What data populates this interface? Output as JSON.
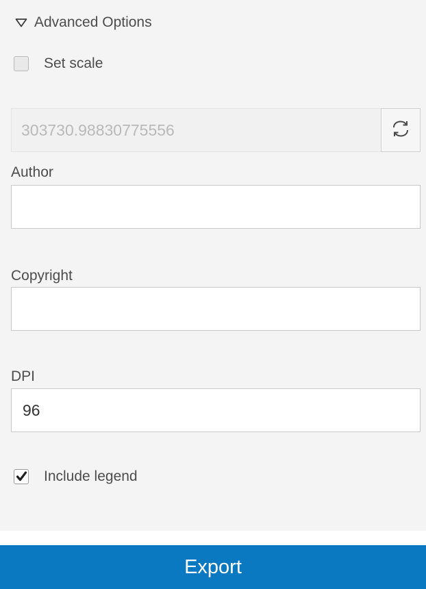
{
  "advanced": {
    "toggle_icon": "triangle-down-icon",
    "label": "Advanced Options"
  },
  "set_scale": {
    "label": "Set scale",
    "checked": false
  },
  "scale": {
    "value": "303730.98830775556",
    "refresh_icon": "refresh-icon"
  },
  "author": {
    "label": "Author",
    "value": ""
  },
  "copyright": {
    "label": "Copyright",
    "value": ""
  },
  "dpi": {
    "label": "DPI",
    "value": "96"
  },
  "include_legend": {
    "label": "Include legend",
    "checked": true,
    "check_icon": "checkmark-icon"
  },
  "export": {
    "label": "Export"
  },
  "colors": {
    "panel_background": "#f4f4f4",
    "export_button": "#0b79c1",
    "text": "#4c4c4c",
    "disabled_text": "#b9b9b9"
  }
}
